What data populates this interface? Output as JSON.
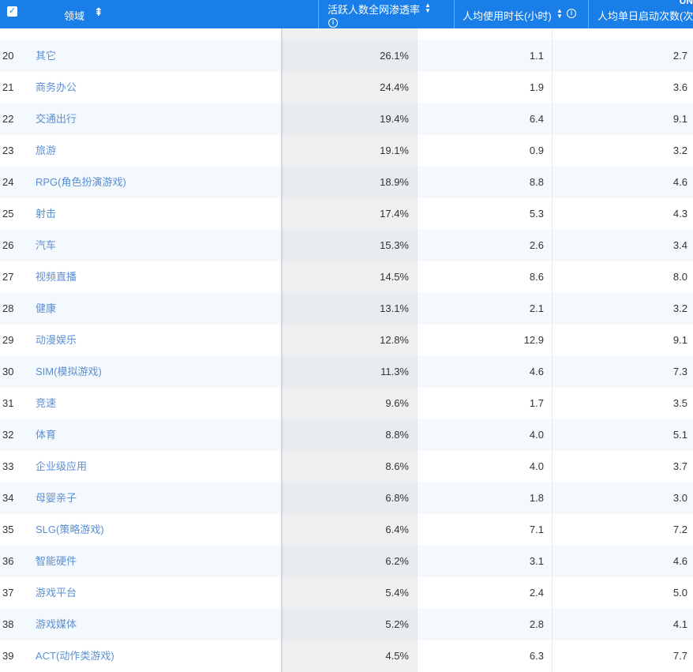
{
  "header": {
    "domain_label": "领域",
    "penetration_label": "活跃人数全网渗透率",
    "duration_label": "人均使用时长(小时)",
    "launch_label": "人均单日启动次数(次",
    "corner_text": "UN",
    "icons": {
      "checkbox": "checkbox-checked-icon",
      "filter": "filter-icon",
      "sort": "sort-icon",
      "info": "info-icon"
    }
  },
  "rows": [
    {
      "idx": "20",
      "name": "其它",
      "penetration": "26.1%",
      "duration": "1.1",
      "launches": "2.7"
    },
    {
      "idx": "21",
      "name": "商务办公",
      "penetration": "24.4%",
      "duration": "1.9",
      "launches": "3.6"
    },
    {
      "idx": "22",
      "name": "交通出行",
      "penetration": "19.4%",
      "duration": "6.4",
      "launches": "9.1"
    },
    {
      "idx": "23",
      "name": "旅游",
      "penetration": "19.1%",
      "duration": "0.9",
      "launches": "3.2"
    },
    {
      "idx": "24",
      "name": "RPG(角色扮演游戏)",
      "penetration": "18.9%",
      "duration": "8.8",
      "launches": "4.6"
    },
    {
      "idx": "25",
      "name": "射击",
      "penetration": "17.4%",
      "duration": "5.3",
      "launches": "4.3"
    },
    {
      "idx": "26",
      "name": "汽车",
      "penetration": "15.3%",
      "duration": "2.6",
      "launches": "3.4"
    },
    {
      "idx": "27",
      "name": "视频直播",
      "penetration": "14.5%",
      "duration": "8.6",
      "launches": "8.0"
    },
    {
      "idx": "28",
      "name": "健康",
      "penetration": "13.1%",
      "duration": "2.1",
      "launches": "3.2"
    },
    {
      "idx": "29",
      "name": "动漫娱乐",
      "penetration": "12.8%",
      "duration": "12.9",
      "launches": "9.1"
    },
    {
      "idx": "30",
      "name": "SIM(模拟游戏)",
      "penetration": "11.3%",
      "duration": "4.6",
      "launches": "7.3"
    },
    {
      "idx": "31",
      "name": "竞速",
      "penetration": "9.6%",
      "duration": "1.7",
      "launches": "3.5"
    },
    {
      "idx": "32",
      "name": "体育",
      "penetration": "8.8%",
      "duration": "4.0",
      "launches": "5.1"
    },
    {
      "idx": "33",
      "name": "企业级应用",
      "penetration": "8.6%",
      "duration": "4.0",
      "launches": "3.7"
    },
    {
      "idx": "34",
      "name": "母婴亲子",
      "penetration": "6.8%",
      "duration": "1.8",
      "launches": "3.0"
    },
    {
      "idx": "35",
      "name": "SLG(策略游戏)",
      "penetration": "6.4%",
      "duration": "7.1",
      "launches": "7.2"
    },
    {
      "idx": "36",
      "name": "智能硬件",
      "penetration": "6.2%",
      "duration": "3.1",
      "launches": "4.6"
    },
    {
      "idx": "37",
      "name": "游戏平台",
      "penetration": "5.4%",
      "duration": "2.4",
      "launches": "5.0"
    },
    {
      "idx": "38",
      "name": "游戏媒体",
      "penetration": "5.2%",
      "duration": "2.8",
      "launches": "4.1"
    },
    {
      "idx": "39",
      "name": "ACT(动作类游戏)",
      "penetration": "4.5%",
      "duration": "6.3",
      "launches": "7.7"
    }
  ],
  "colors": {
    "header_bg": "#1a7ee8",
    "link_text": "#5b8fd4",
    "row_alt_bg": "#f4f9fd",
    "sorted_col_bg": "#f0f0f0"
  }
}
